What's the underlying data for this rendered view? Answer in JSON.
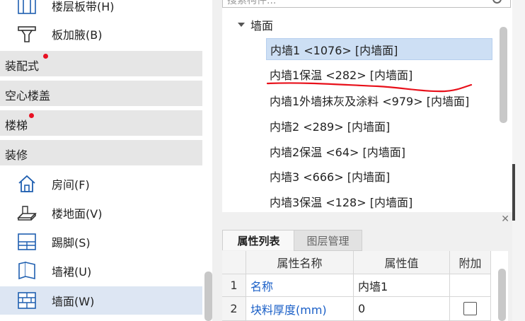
{
  "left_panel": {
    "items_top": [
      {
        "label": "楼层板带(H)",
        "icon": "slab-strip-icon"
      },
      {
        "label": "板加腋(B)",
        "icon": "slab-haunch-icon"
      }
    ],
    "sections": [
      {
        "label": "装配式",
        "badge": true
      },
      {
        "label": "空心楼盖",
        "badge": false
      },
      {
        "label": "楼梯",
        "badge": true
      },
      {
        "label": "装修",
        "badge": false
      }
    ],
    "items_decor": [
      {
        "label": "房间(F)",
        "icon": "house-icon"
      },
      {
        "label": "楼地面(V)",
        "icon": "floor-icon"
      },
      {
        "label": "踢脚(S)",
        "icon": "skirting-icon"
      },
      {
        "label": "墙裙(U)",
        "icon": "dado-icon"
      },
      {
        "label": "墙面(W)",
        "icon": "wall-surface-icon",
        "selected": true
      }
    ]
  },
  "tree": {
    "search_placeholder": "搜索构件...",
    "root": "墙面",
    "items": [
      "内墙1 <1076> [内墙面]",
      "内墙1保温 <282> [内墙面]",
      "内墙1外墙抹灰及涂料 <979> [内墙面]",
      "内墙2 <289> [内墙面]",
      "内墙2保温 <64> [内墙面]",
      "内墙3 <666> [内墙面]",
      "内墙3保温 <128> [内墙面]"
    ],
    "selected_index": 0
  },
  "props": {
    "tabs": [
      "属性列表",
      "图层管理"
    ],
    "headers": [
      "属性名称",
      "属性值",
      "附加"
    ],
    "rows": [
      {
        "num": "1",
        "name": "名称",
        "value": "内墙1",
        "extra_checkbox": false
      },
      {
        "num": "2",
        "name": "块料厚度(mm)",
        "value": "0",
        "extra_checkbox": true
      }
    ]
  },
  "colors": {
    "selected_bg": "#cddff4",
    "badge": "#e81123",
    "link_blue": "#1a5fc7",
    "annotation_red": "#e8101a"
  }
}
